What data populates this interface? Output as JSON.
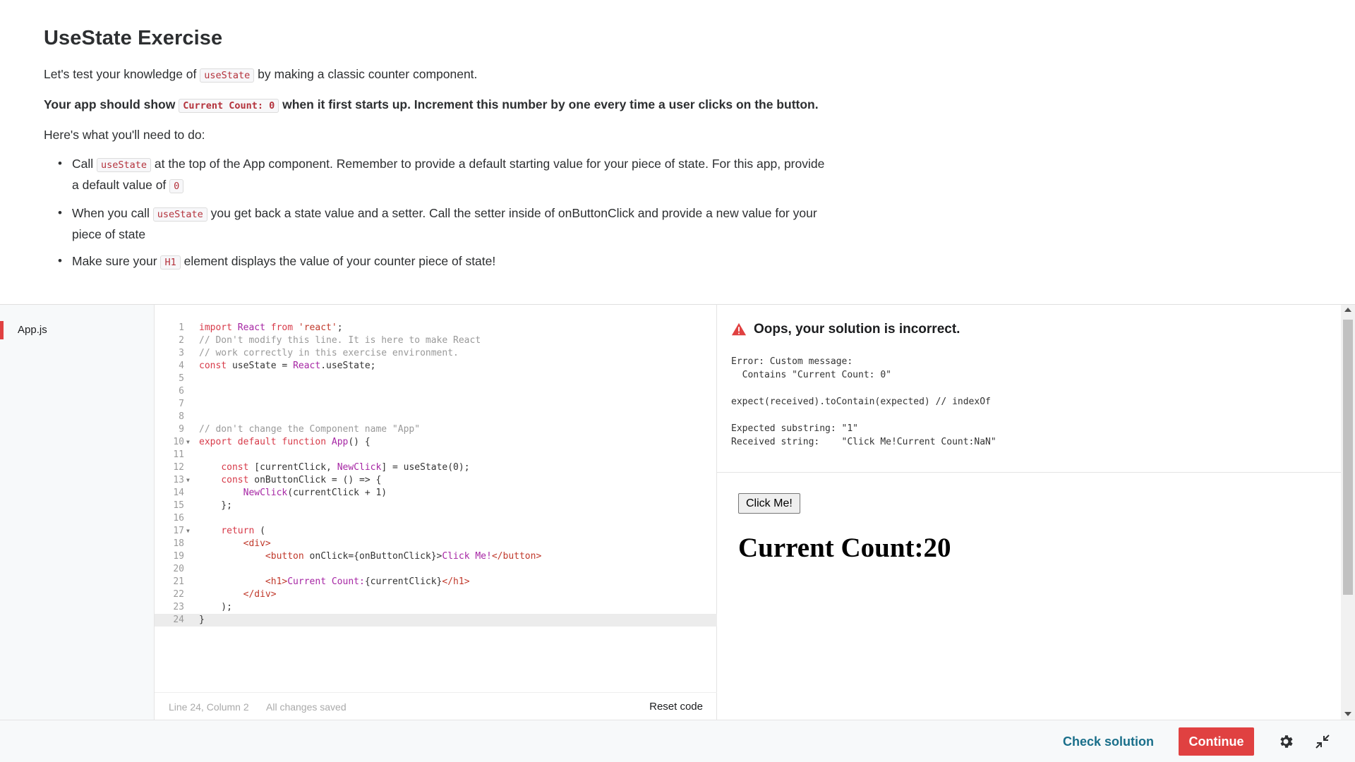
{
  "instructions": {
    "title": "UseState Exercise",
    "intro_pre": "Let's test your knowledge of ",
    "intro_code": "useState",
    "intro_post": " by making a classic counter component.",
    "goal_pre": "Your app should show ",
    "goal_code": "Current Count: 0",
    "goal_post": " when it first starts up.  Increment this number by one every time a user clicks on the button.",
    "todo_heading": "Here's what you'll need to do:",
    "bullet_1_pre": "Call ",
    "bullet_1_code": "useState",
    "bullet_1_mid": " at the top of the App component.  Remember to provide a default starting value for your piece of state.  For this app, provide a default value of ",
    "bullet_1_code2": "0",
    "bullet_2_pre": "When you call ",
    "bullet_2_code": "useState",
    "bullet_2_post": " you get back a state value and a setter.  Call the setter inside of onButtonClick and provide a new value for your piece of state",
    "bullet_3_pre": "Make sure your ",
    "bullet_3_code": "H1",
    "bullet_3_post": " element displays the value of your counter piece of state!"
  },
  "files": {
    "active": "App.js"
  },
  "editor": {
    "lines": [
      "import React from 'react';",
      "// Don't modify this line. It is here to make React",
      "// work correctly in this exercise environment.",
      "const useState = React.useState;",
      "",
      "",
      "",
      "",
      "// don't change the Component name \"App\"",
      "export default function App() {",
      "",
      "    const [currentClick, NewClick] = useState(0);",
      "    const onButtonClick = () => {",
      "        NewClick(currentClick + 1)",
      "    };",
      "",
      "    return (",
      "        <div>",
      "            <button onClick={onButtonClick}>Click Me!</button>",
      "",
      "            <h1>Current Count:{currentClick}</h1>",
      "        </div>",
      "    );",
      "}"
    ],
    "status_position": "Line 24, Column 2",
    "status_saved": "All changes saved",
    "reset_label": "Reset code"
  },
  "result": {
    "error_title": "Oops, your solution is incorrect.",
    "error_text": "Error: Custom message:\n  Contains \"Current Count: 0\"\n\nexpect(received).toContain(expected) // indexOf\n\nExpected substring: \"1\"\nReceived string:    \"Click Me!Current Count:NaN\"",
    "preview_button": "Click Me!",
    "preview_heading": "Current Count:20"
  },
  "footer": {
    "check_label": "Check solution",
    "continue_label": "Continue",
    "accent": "#e04141",
    "link_color": "#1a6f8a"
  },
  "icons": {
    "warning": "warning-icon",
    "gear": "gear-icon",
    "collapse": "collapse-icon"
  }
}
